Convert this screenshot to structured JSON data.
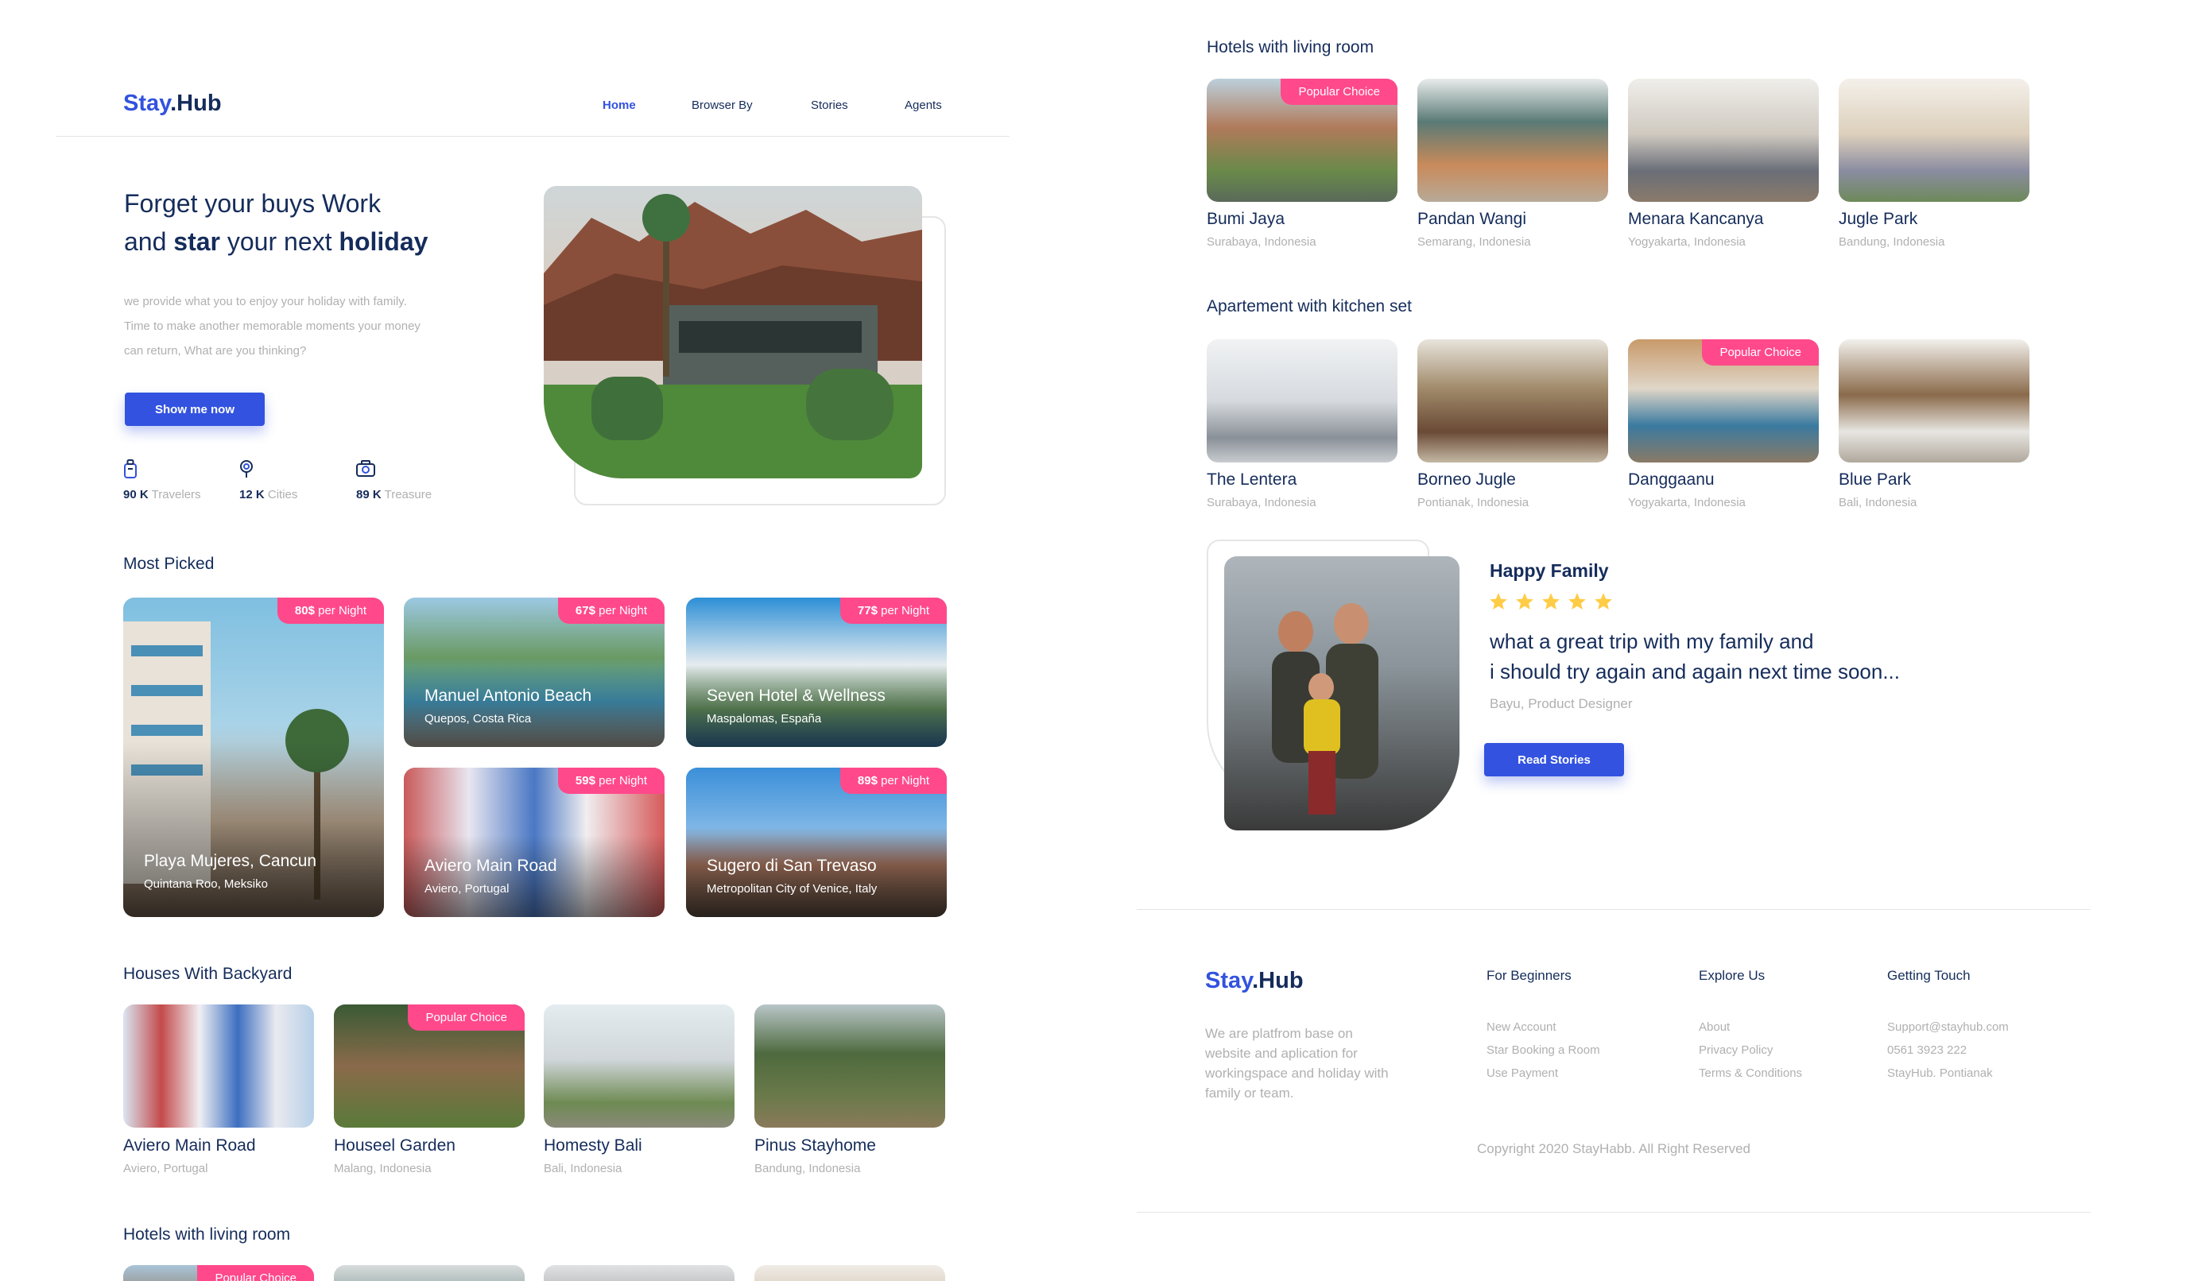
{
  "brand": {
    "first": "Stay",
    "second": ".Hub"
  },
  "nav": {
    "home": "Home",
    "browse": "Browser By",
    "stories": "Stories",
    "agents": "Agents"
  },
  "hero": {
    "line1": "Forget your buys Work",
    "line2_a": "and ",
    "line2_b": "star",
    "line2_c": " your next ",
    "line2_d": "holiday",
    "desc1": "we provide what you to enjoy your holiday with  family.",
    "desc2": "Time to make another memorable moments your money",
    "desc3": "can return, What are you thinking?",
    "cta": "Show me now",
    "stats": [
      {
        "icon": "suitcase-icon",
        "value": "90 K",
        "label": "Travelers"
      },
      {
        "icon": "camera-icon",
        "value": "12 K",
        "label": "Cities"
      },
      {
        "icon": "map-pin-icon",
        "value": "89 K",
        "label": "Treasure"
      }
    ]
  },
  "most_picked": {
    "title": "Most Picked",
    "items": [
      {
        "price": "80$",
        "unit": "per Night",
        "name": "Playa Mujeres, Cancun",
        "loc": "Quintana Roo, Meksiko"
      },
      {
        "price": "67$",
        "unit": "per Night",
        "name": "Manuel Antonio Beach",
        "loc": "Quepos, Costa Rica"
      },
      {
        "price": "77$",
        "unit": "per Night",
        "name": "Seven Hotel & Wellness",
        "loc": "Maspalomas, España"
      },
      {
        "price": "59$",
        "unit": "per Night",
        "name": "Aviero Main Road",
        "loc": "Aviero, Portugal"
      },
      {
        "price": "89$",
        "unit": "per Night",
        "name": "Sugero di San Trevaso",
        "loc": "Metropolitan City of Venice, Italy"
      }
    ]
  },
  "backyard": {
    "title": "Houses With Backyard",
    "popular": "Popular Choice",
    "items": [
      {
        "name": "Aviero Main Road",
        "loc": "Aviero, Portugal"
      },
      {
        "name": "Houseel Garden",
        "loc": "Malang,  Indonesia"
      },
      {
        "name": "Homesty Bali",
        "loc": "Bali,  Indonesia"
      },
      {
        "name": "Pinus Stayhome",
        "loc": "Bandung,  Indonesia"
      }
    ]
  },
  "living_bottom": {
    "title": "Hotels with living room",
    "popular": "Popular Choice"
  },
  "living": {
    "title": "Hotels with living room",
    "popular": "Popular Choice",
    "items": [
      {
        "name": "Bumi Jaya",
        "loc": "Surabaya, Indonesia"
      },
      {
        "name": "Pandan Wangi",
        "loc": "Semarang,  Indonesia"
      },
      {
        "name": "Menara Kancanya",
        "loc": "Yogyakarta,  Indonesia"
      },
      {
        "name": "Jugle Park",
        "loc": "Bandung,  Indonesia"
      }
    ]
  },
  "kitchen": {
    "title": "Apartement with kitchen set",
    "popular": "Popular Choice",
    "items": [
      {
        "name": "The Lentera",
        "loc": "Surabaya, Indonesia"
      },
      {
        "name": "Borneo Jugle",
        "loc": "Pontianak,  Indonesia"
      },
      {
        "name": "Danggaanu",
        "loc": "Yogyakarta,  Indonesia"
      },
      {
        "name": "Blue Park",
        "loc": "Bali,  Indonesia"
      }
    ]
  },
  "testimonial": {
    "title": "Happy Family",
    "rating": 5,
    "quote1": "what a great trip with my family and",
    "quote2": "i should try again and again next time soon...",
    "author": "Bayu, Product Designer",
    "cta": "Read Stories"
  },
  "footer": {
    "about": [
      "We are platfrom  base on",
      "website and aplication for",
      "workingspace and holiday with",
      "family or team."
    ],
    "col1": {
      "title": "For Beginners",
      "links": [
        "New Account",
        "Star Booking a Room",
        "Use Payment"
      ]
    },
    "col2": {
      "title": "Explore Us",
      "links": [
        "About",
        "Privacy Policy",
        "Terms & Conditions"
      ]
    },
    "col3": {
      "title": "Getting Touch",
      "links": [
        "Support@stayhub.com",
        "0561 3923 222",
        "StayHub. Pontianak"
      ]
    },
    "copyright": "Copyright 2020 StayHabb. All Right Reserved"
  },
  "colors": {
    "primary": "#3252DF",
    "dark": "#152C5B",
    "tag": "#FF498B",
    "muted": "#B0B0B0",
    "star": "#FFCC47"
  }
}
